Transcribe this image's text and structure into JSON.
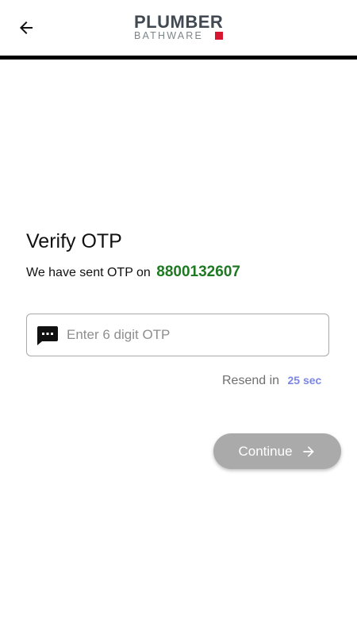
{
  "header": {
    "logo_top": "PLUMBER",
    "logo_bottom": "BATHWARE",
    "back_icon": "arrow-left-icon"
  },
  "main": {
    "title": "Verify OTP",
    "sent_prefix": "We have sent OTP on",
    "phone_number": "8800132607",
    "otp_field": {
      "placeholder": "Enter 6 digit OTP",
      "value": "",
      "icon": "sms-icon"
    },
    "resend_label": "Resend in",
    "resend_timer": "25 sec",
    "continue_label": "Continue",
    "continue_icon": "arrow-right-icon"
  },
  "colors": {
    "phone_number": "#1d7a22",
    "resend_timer": "#7b86e6",
    "continue_button_disabled": "#aaaaaa",
    "logo_accent": "#d7172f",
    "header_divider": "#000000"
  }
}
